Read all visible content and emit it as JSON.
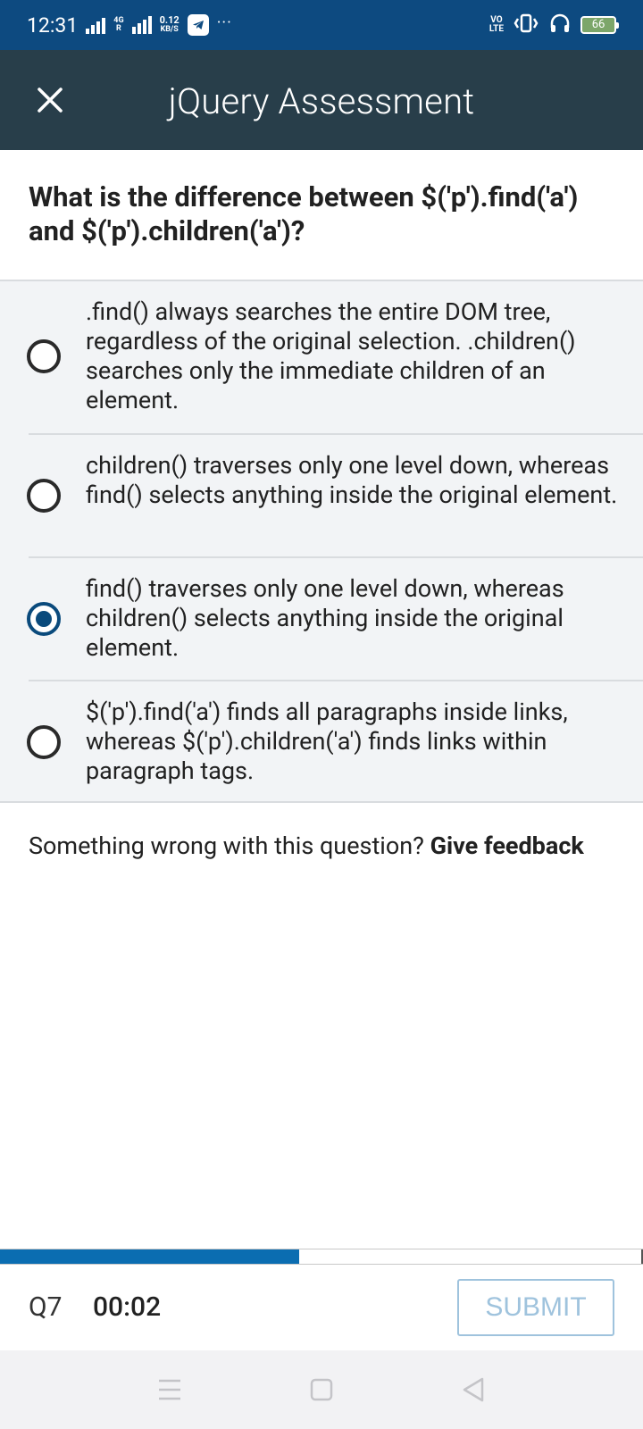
{
  "status_bar": {
    "time": "12:31",
    "network_type": "4G",
    "roaming": "R",
    "net_speed_value": "0.12",
    "net_speed_unit": "KB/S",
    "more": "···",
    "volte_top": "VO",
    "volte_bottom": "LTE",
    "battery": "66"
  },
  "header": {
    "title": "jQuery Assessment"
  },
  "question": {
    "text": "What is the difference between $('p').find('a') and $('p').children('a')?"
  },
  "options": [
    {
      "text": ".find() always searches the entire DOM tree, regardless of the original selection. .children() searches only the immediate children of an element.",
      "selected": false
    },
    {
      "text": "children() traverses only one level down, whereas find() selects anything inside the original element.",
      "selected": false
    },
    {
      "text": "find() traverses only one level down, whereas children() selects anything inside the original element.",
      "selected": true
    },
    {
      "text": "$('p').find('a') finds all paragraphs inside links, whereas $('p').children('a') finds links within paragraph tags.",
      "selected": false
    }
  ],
  "feedback": {
    "prompt": "Something wrong with this question? ",
    "link": "Give feedback"
  },
  "progress": {
    "fraction": 0.465
  },
  "footer": {
    "question_number": "Q7",
    "timer": "00:02",
    "submit_label": "SUBMIT"
  },
  "colors": {
    "status_bar": "#0d4a80",
    "header": "#283e4a",
    "accent": "#0a4a7c",
    "progress": "#0b6db1",
    "submit_disabled": "#9fc3dd"
  }
}
